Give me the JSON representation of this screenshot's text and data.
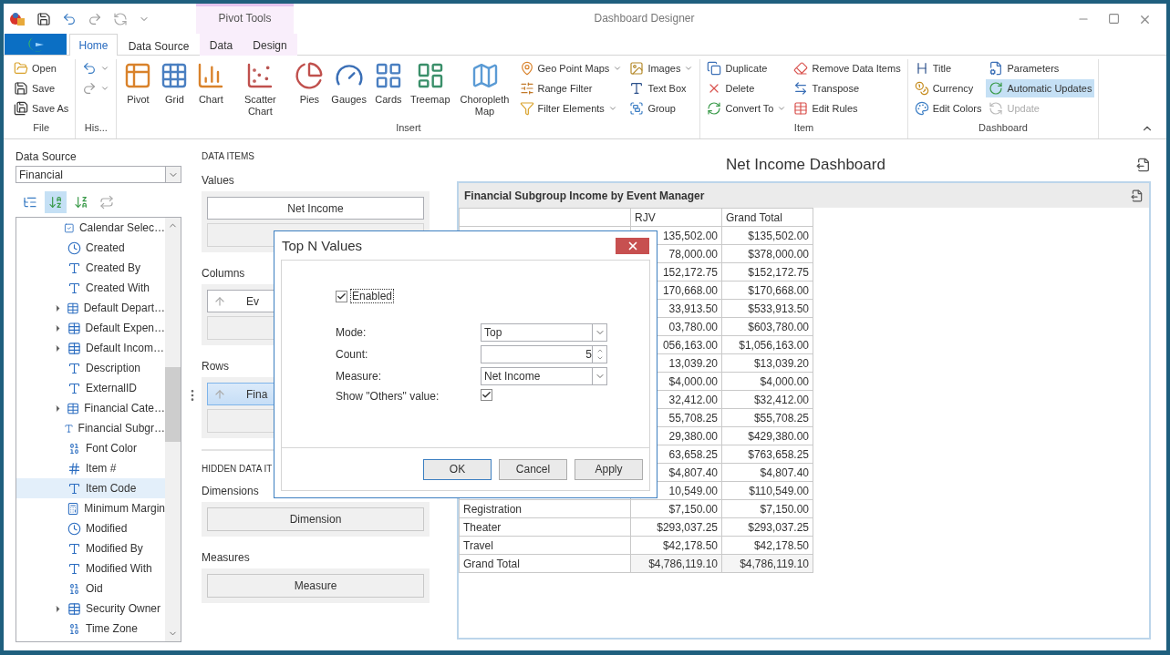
{
  "window": {
    "title": "Dashboard Designer",
    "context_group": "Pivot Tools"
  },
  "tabs": [
    {
      "label": "Home",
      "selected": true,
      "contextual": false
    },
    {
      "label": "Data Source",
      "selected": false,
      "contextual": false
    },
    {
      "label": "Data",
      "selected": false,
      "contextual": true
    },
    {
      "label": "Design",
      "selected": false,
      "contextual": true
    }
  ],
  "ribbon": [
    {
      "label": "File",
      "columns": [
        [
          {
            "label": "Open"
          },
          {
            "label": "Save"
          },
          {
            "label": "Save As"
          }
        ]
      ]
    },
    {
      "label": "His...",
      "columns": [
        [
          {
            "dropdown": true
          },
          {
            "dropdown": true
          }
        ]
      ]
    },
    {
      "label": "Insert",
      "large": [
        {
          "label": "Pivot"
        },
        {
          "label": "Grid"
        },
        {
          "label": "Chart"
        },
        {
          "label": "Scatter Chart"
        },
        {
          "label": "Pies"
        },
        {
          "label": "Gauges"
        },
        {
          "label": "Cards"
        },
        {
          "label": "Treemap"
        },
        {
          "label": "Choropleth Map"
        }
      ],
      "columns": [
        [
          {
            "label": "Geo Point Maps",
            "dropdown": true
          },
          {
            "label": "Range Filter",
            "dropdown": false
          },
          {
            "label": "Filter Elements",
            "dropdown": true
          }
        ],
        [
          {
            "label": "Images",
            "dropdown": true
          },
          {
            "label": "Text Box",
            "dropdown": false
          },
          {
            "label": "Group",
            "dropdown": false
          }
        ]
      ]
    },
    {
      "label": "Item",
      "columns": [
        [
          {
            "label": "Duplicate",
            "dropdown": false
          },
          {
            "label": "Delete",
            "dropdown": false
          },
          {
            "label": "Convert To",
            "dropdown": true
          }
        ],
        [
          {
            "label": "Remove Data Items",
            "dropdown": false
          },
          {
            "label": "Transpose",
            "dropdown": false
          },
          {
            "label": "Edit Rules",
            "dropdown": false
          }
        ]
      ]
    },
    {
      "label": "Dashboard",
      "columns": [
        [
          {
            "label": "Title",
            "selected": false,
            "disabled": false
          },
          {
            "label": "Currency",
            "selected": false,
            "disabled": false
          },
          {
            "label": "Edit Colors",
            "selected": false,
            "disabled": false
          }
        ],
        [
          {
            "label": "Parameters",
            "selected": false,
            "disabled": false
          },
          {
            "label": "Automatic Updates",
            "selected": true,
            "disabled": false
          },
          {
            "label": "Update",
            "selected": false,
            "disabled": true
          }
        ]
      ]
    }
  ],
  "data_source": {
    "label": "Data Source",
    "value": "Financial"
  },
  "field_tools": [
    {
      "selected": false
    },
    {
      "selected": true
    },
    {
      "selected": false
    },
    {
      "selected": false
    }
  ],
  "fields": [
    {
      "label": "Calendar Selec…",
      "kind": "check",
      "expandable": false,
      "selected": false
    },
    {
      "label": "Created",
      "kind": "date",
      "expandable": false,
      "selected": false
    },
    {
      "label": "Created By",
      "kind": "text",
      "expandable": false,
      "selected": false
    },
    {
      "label": "Created With",
      "kind": "text",
      "expandable": false,
      "selected": false
    },
    {
      "label": "Default Depart…",
      "kind": "table",
      "expandable": true,
      "selected": false
    },
    {
      "label": "Default Expen…",
      "kind": "table",
      "expandable": true,
      "selected": false
    },
    {
      "label": "Default Incom…",
      "kind": "table",
      "expandable": true,
      "selected": false
    },
    {
      "label": "Description",
      "kind": "text",
      "expandable": false,
      "selected": false
    },
    {
      "label": "ExternalID",
      "kind": "text",
      "expandable": false,
      "selected": false
    },
    {
      "label": "Financial Cate…",
      "kind": "table",
      "expandable": true,
      "selected": false
    },
    {
      "label": "Financial Subgr…",
      "kind": "text",
      "expandable": false,
      "selected": false
    },
    {
      "label": "Font Color",
      "kind": "number",
      "expandable": false,
      "selected": false
    },
    {
      "label": "Item #",
      "kind": "integer",
      "expandable": false,
      "selected": false
    },
    {
      "label": "Item Code",
      "kind": "text",
      "expandable": false,
      "selected": true
    },
    {
      "label": "Minimum Margin",
      "kind": "decimal",
      "expandable": false,
      "selected": false
    },
    {
      "label": "Modified",
      "kind": "date",
      "expandable": false,
      "selected": false
    },
    {
      "label": "Modified By",
      "kind": "text",
      "expandable": false,
      "selected": false
    },
    {
      "label": "Modified With",
      "kind": "text",
      "expandable": false,
      "selected": false
    },
    {
      "label": "Oid",
      "kind": "number",
      "expandable": false,
      "selected": false
    },
    {
      "label": "Security Owner",
      "kind": "table",
      "expandable": true,
      "selected": false
    },
    {
      "label": "Time Zone",
      "kind": "number",
      "expandable": false,
      "selected": false
    }
  ],
  "data_items": {
    "title": "DATA ITEMS",
    "sections": [
      {
        "label": "Values",
        "items": [
          {
            "text": "Net Income",
            "kind": "measure",
            "selected": false
          }
        ]
      },
      {
        "label": "Columns",
        "items": [
          {
            "text": "Ev",
            "kind": "dimension",
            "selected": false
          }
        ]
      },
      {
        "label": "Rows",
        "items": [
          {
            "text": "Fina",
            "kind": "dimension",
            "selected": true
          }
        ]
      }
    ]
  },
  "hidden_items": {
    "title": "HIDDEN DATA IT",
    "sections": [
      {
        "label": "Dimensions",
        "placeholder": "Dimension"
      },
      {
        "label": "Measures",
        "placeholder": "Measure"
      }
    ]
  },
  "dashboard": {
    "title": "Net Income Dashboard",
    "item": {
      "title": "Financial Subgroup Income by Event Manager",
      "columns": [
        "RJV",
        "Grand Total"
      ],
      "rows": [
        {
          "values": [
            "135,502.00",
            "$135,502.00"
          ]
        },
        {
          "values": [
            "78,000.00",
            "$378,000.00"
          ]
        },
        {
          "values": [
            "152,172.75",
            "$152,172.75"
          ]
        },
        {
          "values": [
            "170,668.00",
            "$170,668.00"
          ]
        },
        {
          "values": [
            "33,913.50",
            "$533,913.50"
          ]
        },
        {
          "values": [
            "03,780.00",
            "$603,780.00"
          ]
        },
        {
          "values": [
            "056,163.00",
            "$1,056,163.00"
          ]
        },
        {
          "values": [
            "13,039.20",
            "$13,039.20"
          ]
        },
        {
          "values": [
            "$4,000.00",
            "$4,000.00"
          ]
        },
        {
          "values": [
            "32,412.00",
            "$32,412.00"
          ]
        },
        {
          "values": [
            "55,708.25",
            "$55,708.25"
          ]
        },
        {
          "values": [
            "29,380.00",
            "$429,380.00"
          ]
        },
        {
          "values": [
            "63,658.25",
            "$763,658.25"
          ]
        },
        {
          "values": [
            "$4,807.40",
            "$4,807.40"
          ]
        },
        {
          "values": [
            "10,549.00",
            "$110,549.00"
          ]
        },
        {
          "label": "Registration",
          "values": [
            "$7,150.00",
            "$7,150.00"
          ]
        },
        {
          "label": "Theater",
          "values": [
            "$293,037.25",
            "$293,037.25"
          ]
        },
        {
          "label": "Travel",
          "values": [
            "$42,178.50",
            "$42,178.50"
          ]
        }
      ],
      "total": {
        "label": "Grand Total",
        "values": [
          "$4,786,119.10",
          "$4,786,119.10"
        ]
      }
    }
  },
  "dialog": {
    "title": "Top N Values",
    "enabled": {
      "label": "Enabled",
      "checked": true
    },
    "mode": {
      "label": "Mode:",
      "value": "Top"
    },
    "count": {
      "label": "Count:",
      "value": "5"
    },
    "measure": {
      "label": "Measure:",
      "value": "Net Income"
    },
    "show_others": {
      "label": "Show \"Others\" value:",
      "checked": true
    },
    "buttons": [
      {
        "label": "OK",
        "default": true
      },
      {
        "label": "Cancel",
        "default": false
      },
      {
        "label": "Apply",
        "default": false
      }
    ]
  }
}
